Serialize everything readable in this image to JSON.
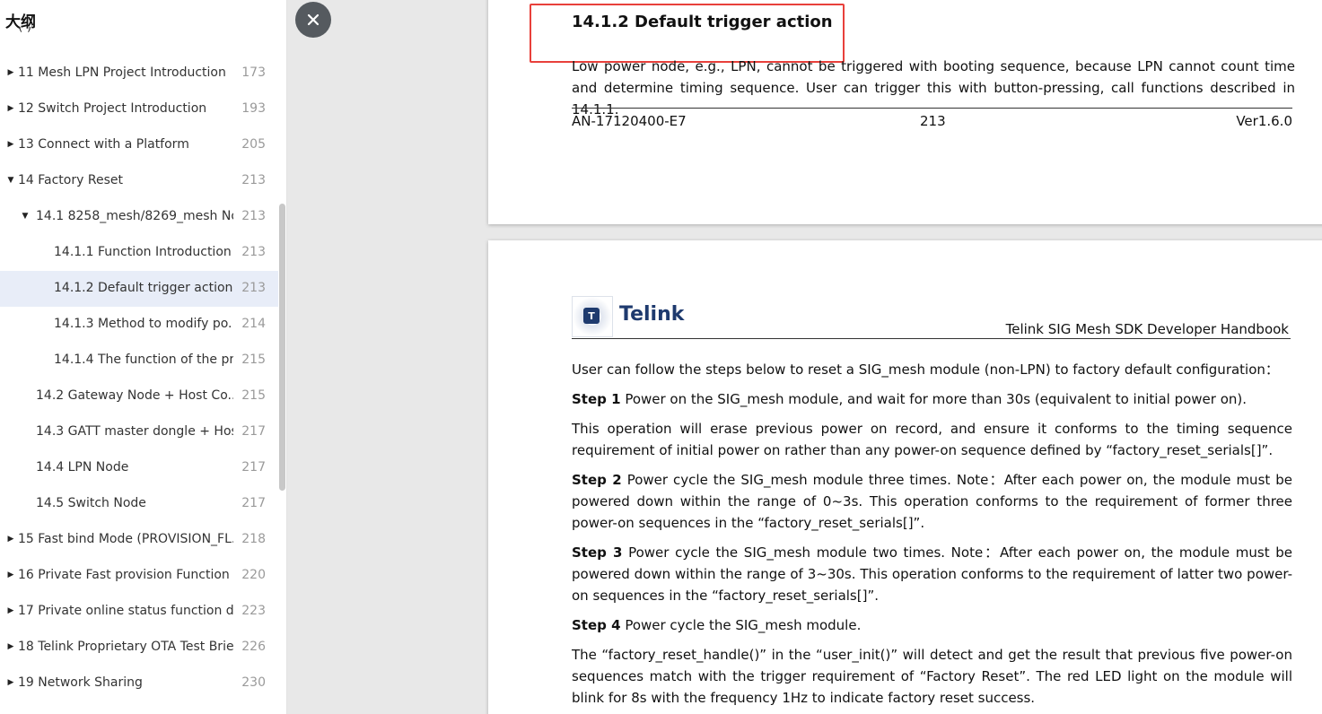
{
  "sidebar": {
    "title": "大纲",
    "cut_item_text": "(               )",
    "items": [
      {
        "label": "11 Mesh LPN Project Introduction",
        "page": "173",
        "level": 0,
        "caret": "right"
      },
      {
        "label": "12 Switch Project Introduction",
        "page": "193",
        "level": 0,
        "caret": "right"
      },
      {
        "label": "13 Connect with a Platform",
        "page": "205",
        "level": 0,
        "caret": "right"
      },
      {
        "label": "14 Factory Reset",
        "page": "213",
        "level": 0,
        "caret": "down"
      },
      {
        "label": "14.1 8258_mesh/8269_mesh No...",
        "page": "213",
        "level": 1,
        "caret": "down"
      },
      {
        "label": "14.1.1 Function Introduction",
        "page": "213",
        "level": 2,
        "caret": ""
      },
      {
        "label": "14.1.2 Default trigger action",
        "page": "213",
        "level": 2,
        "caret": "",
        "selected": true
      },
      {
        "label": "14.1.3 Method to modify po...",
        "page": "214",
        "level": 2,
        "caret": ""
      },
      {
        "label": "14.1.4 The function of the pr...",
        "page": "215",
        "level": 2,
        "caret": ""
      },
      {
        "label": "14.2 Gateway Node + Host Co...",
        "page": "215",
        "level": 1,
        "caret": ""
      },
      {
        "label": "14.3 GATT master dongle + Hos...",
        "page": "217",
        "level": 1,
        "caret": ""
      },
      {
        "label": "14.4 LPN Node",
        "page": "217",
        "level": 1,
        "caret": ""
      },
      {
        "label": "14.5 Switch Node",
        "page": "217",
        "level": 1,
        "caret": ""
      },
      {
        "label": "15 Fast bind Mode (PROVISION_FL...",
        "page": "218",
        "level": 0,
        "caret": "right"
      },
      {
        "label": "16 Private Fast provision Function",
        "page": "220",
        "level": 0,
        "caret": "right"
      },
      {
        "label": "17 Private online status function d...",
        "page": "223",
        "level": 0,
        "caret": "right"
      },
      {
        "label": "18 Telink Proprietary OTA Test Brief",
        "page": "226",
        "level": 0,
        "caret": "right"
      },
      {
        "label": "19 Network Sharing",
        "page": "230",
        "level": 0,
        "caret": "right"
      }
    ]
  },
  "close_icon": "close-icon",
  "page_a": {
    "heading": "14.1.2  Default trigger action",
    "paragraph": "Low power node, e.g., LPN, cannot be triggered with booting sequence, because LPN cannot count time and determine timing sequence. User can trigger this with button-pressing, call functions described in 14.1.1.",
    "footer_left": "AN-17120400-E7",
    "footer_center": "213",
    "footer_right": "Ver1.6.0"
  },
  "page_b": {
    "logo_mark": "T",
    "logo_text": "Telink",
    "header_title": "Telink SIG Mesh SDK Developer Handbook",
    "intro": "User can follow the steps below to reset a SIG_mesh module (non-LPN) to factory default configuration：",
    "step1_label": "Step 1",
    "step1_text": " Power on the SIG_mesh module, and wait for more than 30s (equivalent to initial power on).",
    "step1_note": "This operation will erase previous power on record, and ensure it conforms to the timing sequence requirement of initial power on rather than any power-on sequence defined by “factory_reset_serials[]”.",
    "step2_label": "Step 2",
    "step2_text": " Power cycle the SIG_mesh module three times. Note：After each power on, the module must be powered down within the range of 0~3s. This operation conforms to the requirement of former three power-on sequences in the “factory_reset_serials[]”.",
    "step3_label": "Step 3",
    "step3_text": " Power cycle the SIG_mesh module two times. Note：After each power on, the module must be powered down within the range of 3~30s. This operation conforms to the requirement of latter two power-on sequences in the “factory_reset_serials[]”.",
    "step4_label": "Step 4",
    "step4_text": " Power cycle the SIG_mesh module.",
    "conclusion": "The “factory_reset_handle()” in the “user_init()” will detect and get the result that previous five power-on sequences match with the trigger requirement of “Factory Reset”. The red LED light on the module will blink for 8s with the frequency 1Hz to indicate factory reset success."
  },
  "colors": {
    "highlight_box": "#e8403b",
    "selected_row": "#e8edf8",
    "close_button": "#555a5f",
    "logo_blue": "#1e3a6e"
  }
}
